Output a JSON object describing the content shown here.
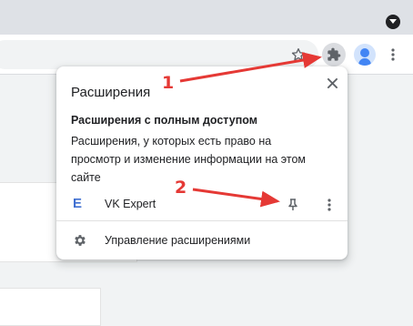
{
  "colors": {
    "annotation": "#e53935",
    "extension_logo": "#3f6fd1",
    "text": "#202124",
    "toolbar_bg": "#ffffff",
    "tabstrip_bg": "#dee1e6"
  },
  "browser": {
    "icons": [
      "tab-search-icon",
      "star-icon",
      "puzzle-icon",
      "avatar",
      "more-vert-icon"
    ]
  },
  "popup": {
    "title": "Расширения",
    "section_title": "Расширения с полным доступом",
    "section_desc": "Расширения, у которых есть право на просмотр и изменение информации на этом сайте",
    "extension": {
      "logo": "E",
      "name": "VK Expert"
    },
    "manage_label": "Управление расширениями"
  },
  "annotations": {
    "marker1": "1",
    "marker2": "2"
  }
}
